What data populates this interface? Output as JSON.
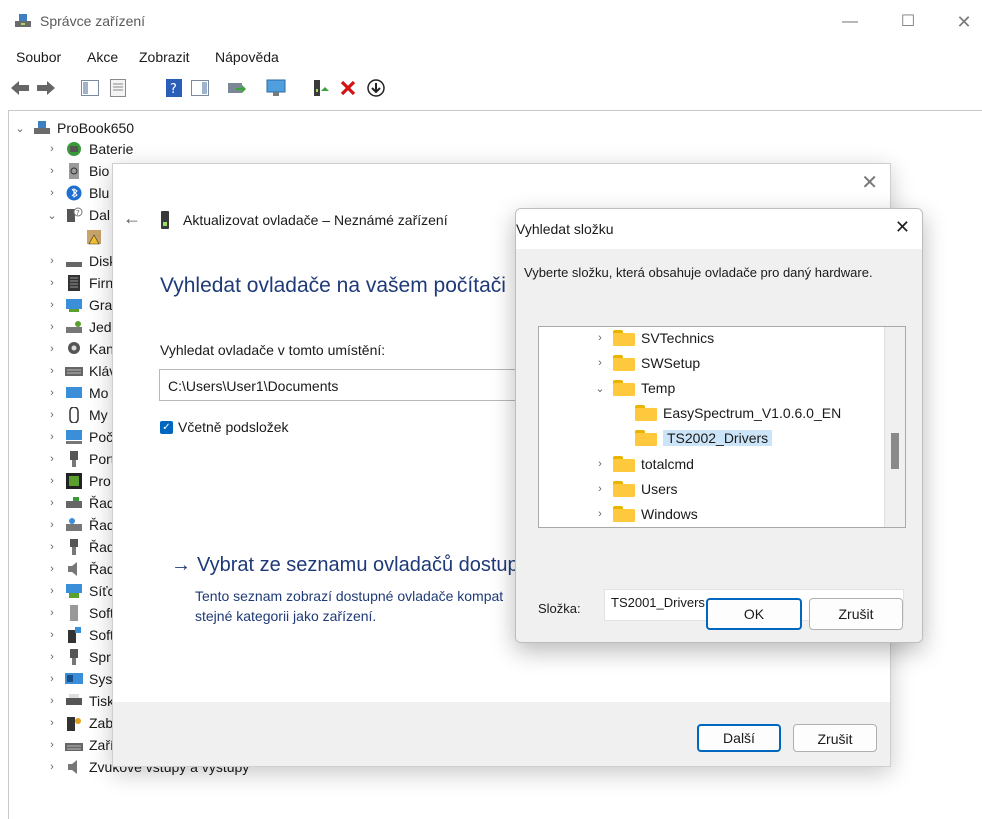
{
  "window": {
    "title": "Správce zařízení"
  },
  "menu": [
    "Soubor",
    "Akce",
    "Zobrazit",
    "Nápověda"
  ],
  "tree": {
    "root": "ProBook650",
    "items": [
      {
        "label": "Baterie"
      },
      {
        "label": "Bio"
      },
      {
        "label": "Blu"
      },
      {
        "label": "Dal"
      },
      {
        "label": ""
      },
      {
        "label": "Disk"
      },
      {
        "label": "Firn"
      },
      {
        "label": "Gra"
      },
      {
        "label": "Jedi"
      },
      {
        "label": "Kan"
      },
      {
        "label": "Kláv"
      },
      {
        "label": "Mo"
      },
      {
        "label": "My"
      },
      {
        "label": "Poč"
      },
      {
        "label": "Port"
      },
      {
        "label": "Pro"
      },
      {
        "label": "Řad"
      },
      {
        "label": "Řad"
      },
      {
        "label": "Řad"
      },
      {
        "label": "Řad"
      },
      {
        "label": "Síťc"
      },
      {
        "label": "Soft"
      },
      {
        "label": "Soft"
      },
      {
        "label": "Spr"
      },
      {
        "label": "Syst"
      },
      {
        "label": "Tisk"
      },
      {
        "label": "Zab"
      },
      {
        "label": "Zařízení standardu HID"
      },
      {
        "label": "Zvukové vstupy a výstupy"
      }
    ]
  },
  "wizard": {
    "header": "Aktualizovat ovladače – Neznámé zařízení",
    "heading": "Vyhledat ovladače na vašem počítači",
    "location_label": "Vyhledat ovladače v tomto umístění:",
    "location_value": "C:\\Users\\User1\\Documents",
    "include_subfolders": "Včetně podsložek",
    "link": "Vybrat ze seznamu ovladačů dostupn",
    "link_desc": "Tento seznam zobrazí dostupné ovladače kompat stejné kategorii jako zařízení.",
    "next": "Další",
    "cancel": "Zrušit"
  },
  "browse": {
    "title": "Vyhledat složku",
    "description": "Vyberte složku, která obsahuje ovladače pro daný hardware.",
    "folders": [
      {
        "label": "SVTechnics"
      },
      {
        "label": "SWSetup"
      },
      {
        "label": "Temp"
      },
      {
        "label": "EasySpectrum_V1.0.6.0_EN"
      },
      {
        "label": "TS2002_Drivers"
      },
      {
        "label": "totalcmd"
      },
      {
        "label": "Users"
      },
      {
        "label": "Windows"
      }
    ],
    "folder_label": "Složka:",
    "folder_value": "TS2001_Drivers",
    "ok": "OK",
    "cancel": "Zrušit"
  }
}
